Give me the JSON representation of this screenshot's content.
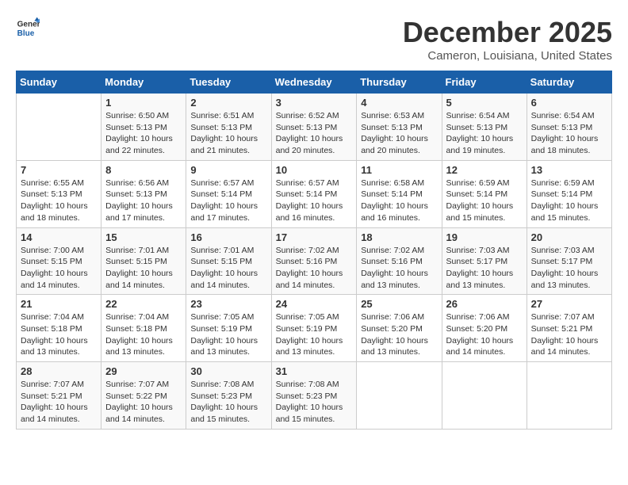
{
  "header": {
    "logo_line1": "General",
    "logo_line2": "Blue",
    "title": "December 2025",
    "subtitle": "Cameron, Louisiana, United States"
  },
  "weekdays": [
    "Sunday",
    "Monday",
    "Tuesday",
    "Wednesday",
    "Thursday",
    "Friday",
    "Saturday"
  ],
  "weeks": [
    [
      {
        "day": "",
        "sunrise": "",
        "sunset": "",
        "daylight": ""
      },
      {
        "day": "1",
        "sunrise": "Sunrise: 6:50 AM",
        "sunset": "Sunset: 5:13 PM",
        "daylight": "Daylight: 10 hours and 22 minutes."
      },
      {
        "day": "2",
        "sunrise": "Sunrise: 6:51 AM",
        "sunset": "Sunset: 5:13 PM",
        "daylight": "Daylight: 10 hours and 21 minutes."
      },
      {
        "day": "3",
        "sunrise": "Sunrise: 6:52 AM",
        "sunset": "Sunset: 5:13 PM",
        "daylight": "Daylight: 10 hours and 20 minutes."
      },
      {
        "day": "4",
        "sunrise": "Sunrise: 6:53 AM",
        "sunset": "Sunset: 5:13 PM",
        "daylight": "Daylight: 10 hours and 20 minutes."
      },
      {
        "day": "5",
        "sunrise": "Sunrise: 6:54 AM",
        "sunset": "Sunset: 5:13 PM",
        "daylight": "Daylight: 10 hours and 19 minutes."
      },
      {
        "day": "6",
        "sunrise": "Sunrise: 6:54 AM",
        "sunset": "Sunset: 5:13 PM",
        "daylight": "Daylight: 10 hours and 18 minutes."
      }
    ],
    [
      {
        "day": "7",
        "sunrise": "Sunrise: 6:55 AM",
        "sunset": "Sunset: 5:13 PM",
        "daylight": "Daylight: 10 hours and 18 minutes."
      },
      {
        "day": "8",
        "sunrise": "Sunrise: 6:56 AM",
        "sunset": "Sunset: 5:13 PM",
        "daylight": "Daylight: 10 hours and 17 minutes."
      },
      {
        "day": "9",
        "sunrise": "Sunrise: 6:57 AM",
        "sunset": "Sunset: 5:14 PM",
        "daylight": "Daylight: 10 hours and 17 minutes."
      },
      {
        "day": "10",
        "sunrise": "Sunrise: 6:57 AM",
        "sunset": "Sunset: 5:14 PM",
        "daylight": "Daylight: 10 hours and 16 minutes."
      },
      {
        "day": "11",
        "sunrise": "Sunrise: 6:58 AM",
        "sunset": "Sunset: 5:14 PM",
        "daylight": "Daylight: 10 hours and 16 minutes."
      },
      {
        "day": "12",
        "sunrise": "Sunrise: 6:59 AM",
        "sunset": "Sunset: 5:14 PM",
        "daylight": "Daylight: 10 hours and 15 minutes."
      },
      {
        "day": "13",
        "sunrise": "Sunrise: 6:59 AM",
        "sunset": "Sunset: 5:14 PM",
        "daylight": "Daylight: 10 hours and 15 minutes."
      }
    ],
    [
      {
        "day": "14",
        "sunrise": "Sunrise: 7:00 AM",
        "sunset": "Sunset: 5:15 PM",
        "daylight": "Daylight: 10 hours and 14 minutes."
      },
      {
        "day": "15",
        "sunrise": "Sunrise: 7:01 AM",
        "sunset": "Sunset: 5:15 PM",
        "daylight": "Daylight: 10 hours and 14 minutes."
      },
      {
        "day": "16",
        "sunrise": "Sunrise: 7:01 AM",
        "sunset": "Sunset: 5:15 PM",
        "daylight": "Daylight: 10 hours and 14 minutes."
      },
      {
        "day": "17",
        "sunrise": "Sunrise: 7:02 AM",
        "sunset": "Sunset: 5:16 PM",
        "daylight": "Daylight: 10 hours and 14 minutes."
      },
      {
        "day": "18",
        "sunrise": "Sunrise: 7:02 AM",
        "sunset": "Sunset: 5:16 PM",
        "daylight": "Daylight: 10 hours and 13 minutes."
      },
      {
        "day": "19",
        "sunrise": "Sunrise: 7:03 AM",
        "sunset": "Sunset: 5:17 PM",
        "daylight": "Daylight: 10 hours and 13 minutes."
      },
      {
        "day": "20",
        "sunrise": "Sunrise: 7:03 AM",
        "sunset": "Sunset: 5:17 PM",
        "daylight": "Daylight: 10 hours and 13 minutes."
      }
    ],
    [
      {
        "day": "21",
        "sunrise": "Sunrise: 7:04 AM",
        "sunset": "Sunset: 5:18 PM",
        "daylight": "Daylight: 10 hours and 13 minutes."
      },
      {
        "day": "22",
        "sunrise": "Sunrise: 7:04 AM",
        "sunset": "Sunset: 5:18 PM",
        "daylight": "Daylight: 10 hours and 13 minutes."
      },
      {
        "day": "23",
        "sunrise": "Sunrise: 7:05 AM",
        "sunset": "Sunset: 5:19 PM",
        "daylight": "Daylight: 10 hours and 13 minutes."
      },
      {
        "day": "24",
        "sunrise": "Sunrise: 7:05 AM",
        "sunset": "Sunset: 5:19 PM",
        "daylight": "Daylight: 10 hours and 13 minutes."
      },
      {
        "day": "25",
        "sunrise": "Sunrise: 7:06 AM",
        "sunset": "Sunset: 5:20 PM",
        "daylight": "Daylight: 10 hours and 13 minutes."
      },
      {
        "day": "26",
        "sunrise": "Sunrise: 7:06 AM",
        "sunset": "Sunset: 5:20 PM",
        "daylight": "Daylight: 10 hours and 14 minutes."
      },
      {
        "day": "27",
        "sunrise": "Sunrise: 7:07 AM",
        "sunset": "Sunset: 5:21 PM",
        "daylight": "Daylight: 10 hours and 14 minutes."
      }
    ],
    [
      {
        "day": "28",
        "sunrise": "Sunrise: 7:07 AM",
        "sunset": "Sunset: 5:21 PM",
        "daylight": "Daylight: 10 hours and 14 minutes."
      },
      {
        "day": "29",
        "sunrise": "Sunrise: 7:07 AM",
        "sunset": "Sunset: 5:22 PM",
        "daylight": "Daylight: 10 hours and 14 minutes."
      },
      {
        "day": "30",
        "sunrise": "Sunrise: 7:08 AM",
        "sunset": "Sunset: 5:23 PM",
        "daylight": "Daylight: 10 hours and 15 minutes."
      },
      {
        "day": "31",
        "sunrise": "Sunrise: 7:08 AM",
        "sunset": "Sunset: 5:23 PM",
        "daylight": "Daylight: 10 hours and 15 minutes."
      },
      {
        "day": "",
        "sunrise": "",
        "sunset": "",
        "daylight": ""
      },
      {
        "day": "",
        "sunrise": "",
        "sunset": "",
        "daylight": ""
      },
      {
        "day": "",
        "sunrise": "",
        "sunset": "",
        "daylight": ""
      }
    ]
  ]
}
